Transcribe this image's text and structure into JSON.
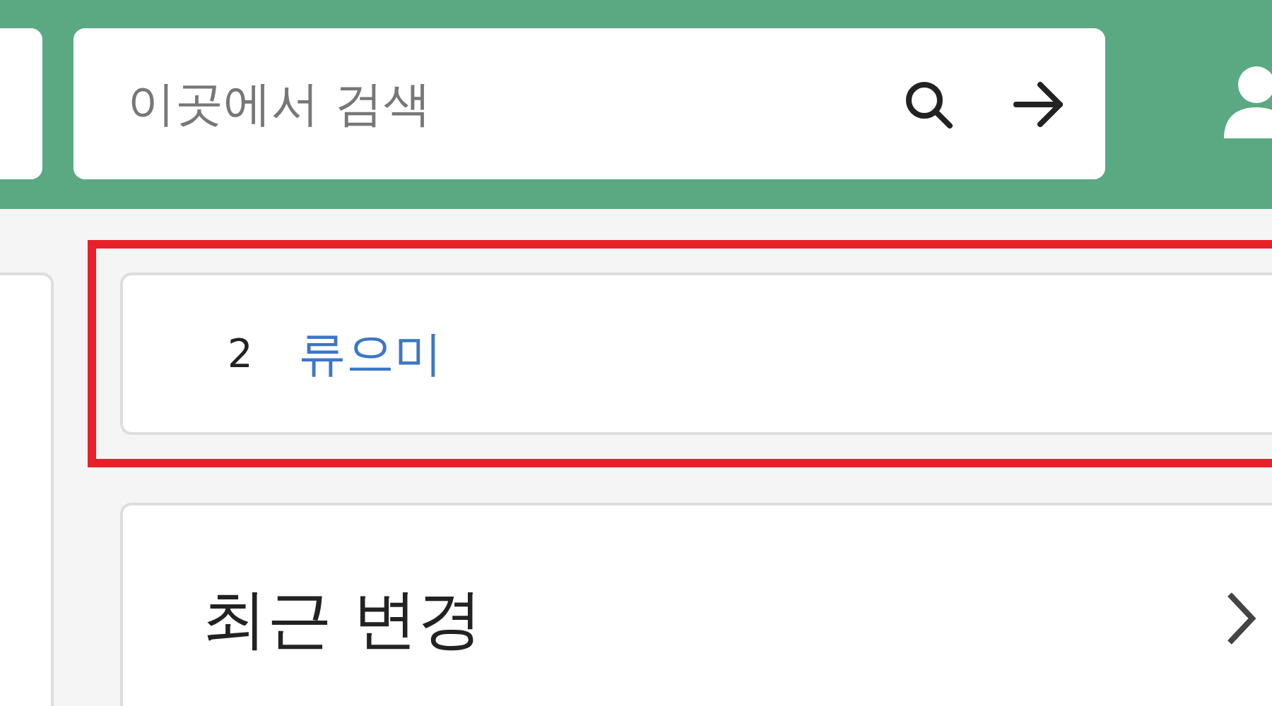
{
  "search": {
    "placeholder": "이곳에서 검색"
  },
  "ranking_item": {
    "number": "2",
    "name": "류으미"
  },
  "recent_changes": {
    "title": "최근 변경"
  }
}
